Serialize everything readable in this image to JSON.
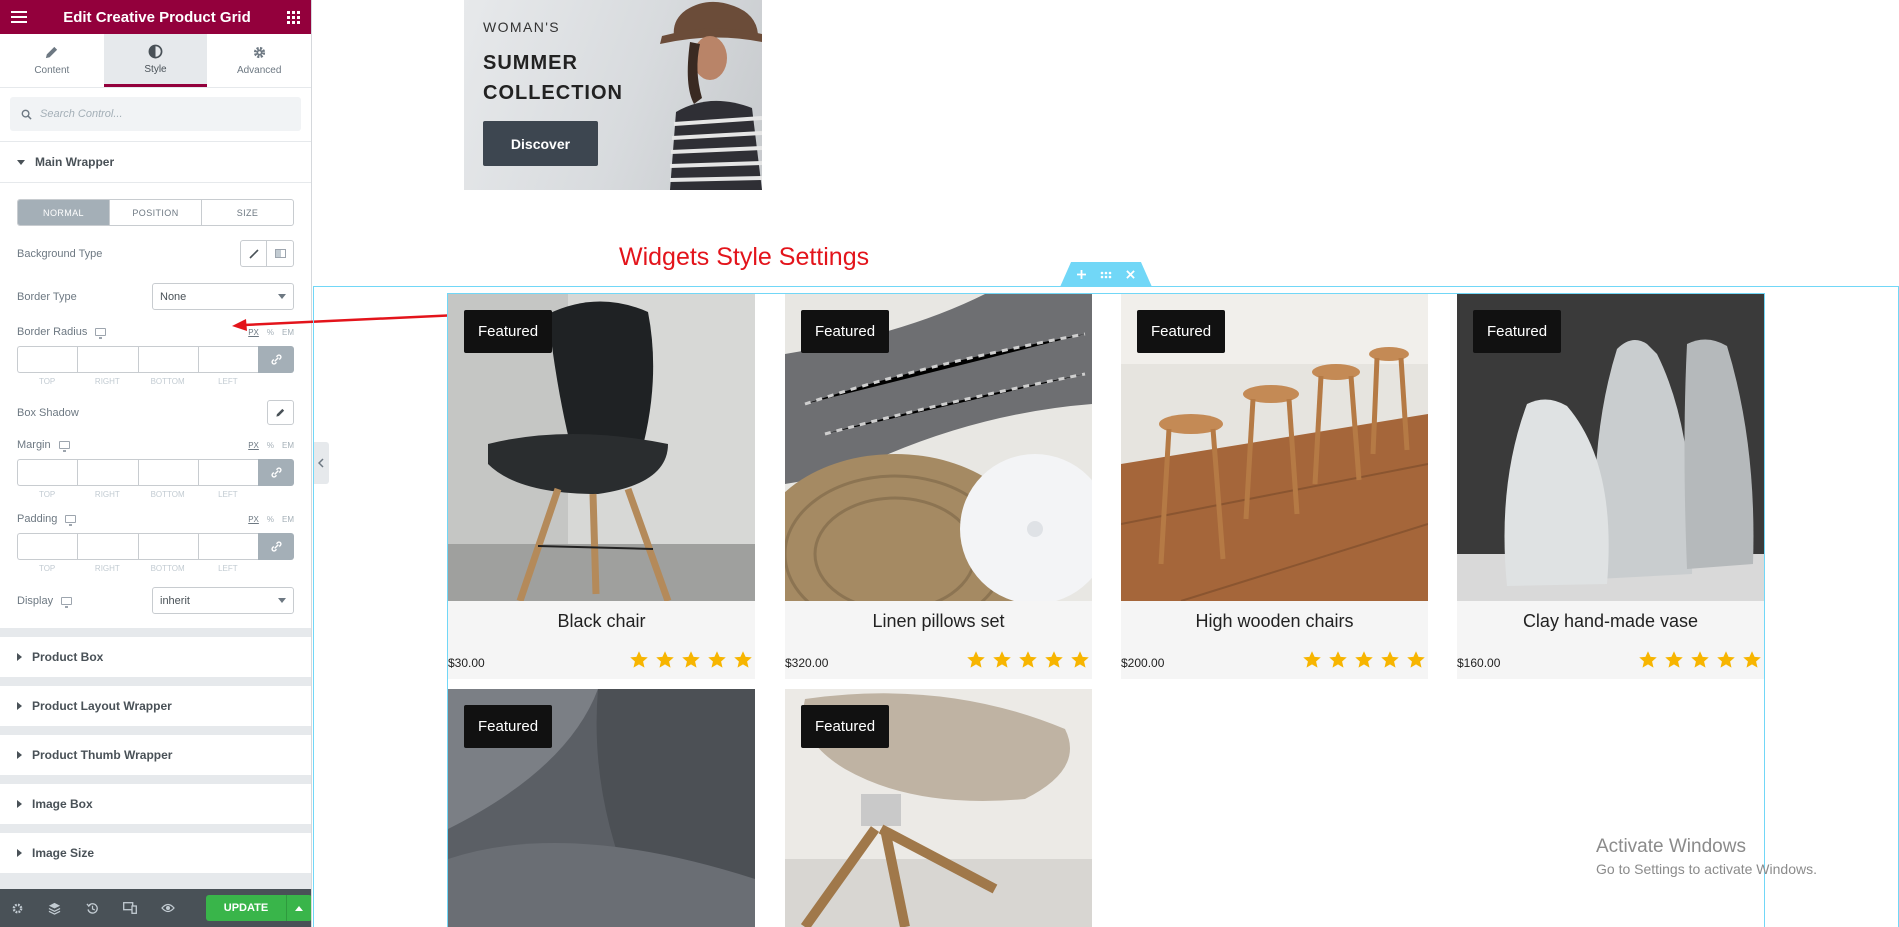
{
  "editor": {
    "title": "Edit Creative Product Grid",
    "tabs": [
      {
        "label": "Content"
      },
      {
        "label": "Style"
      },
      {
        "label": "Advanced"
      }
    ],
    "search_placeholder": "Search Control...",
    "main_wrapper": {
      "title": "Main Wrapper",
      "state_tabs": [
        "NORMAL",
        "POSITION",
        "SIZE"
      ],
      "background_type_label": "Background Type",
      "border_type_label": "Border Type",
      "border_type_value": "None",
      "border_radius_label": "Border Radius",
      "box_shadow_label": "Box Shadow",
      "margin_label": "Margin",
      "padding_label": "Padding",
      "display_label": "Display",
      "display_value": "inherit",
      "units": [
        "PX",
        "%",
        "EM"
      ],
      "dimension_labels": [
        "TOP",
        "RIGHT",
        "BOTTOM",
        "LEFT"
      ]
    },
    "collapsed_sections": [
      "Product Box",
      "Product Layout Wrapper",
      "Product Thumb Wrapper",
      "Image Box",
      "Image Size"
    ],
    "footer": {
      "update_label": "UPDATE"
    }
  },
  "banner": {
    "eyebrow": "WOMAN'S",
    "headline": "SUMMER COLLECTION",
    "button_label": "Discover"
  },
  "annotation": "Widgets Style Settings",
  "products": [
    {
      "badge": "Featured",
      "title": "Black chair",
      "price": "$30.00",
      "rating": 5
    },
    {
      "badge": "Featured",
      "title": "Linen pillows set",
      "price": "$320.00",
      "rating": 5
    },
    {
      "badge": "Featured",
      "title": "High wooden chairs",
      "price": "$200.00",
      "rating": 5
    },
    {
      "badge": "Featured",
      "title": "Clay hand-made vase",
      "price": "$160.00",
      "rating": 5
    },
    {
      "badge": "Featured",
      "title": "",
      "price": "",
      "rating": 0
    },
    {
      "badge": "Featured",
      "title": "",
      "price": "",
      "rating": 0
    }
  ],
  "colors": {
    "brand": "#93003c",
    "star": "#f7b500",
    "outline": "#71d7f7",
    "annotation": "#e3141b",
    "update": "#39b54a"
  },
  "watermark": {
    "line1": "Activate Windows",
    "line2": "Go to Settings to activate Windows."
  }
}
